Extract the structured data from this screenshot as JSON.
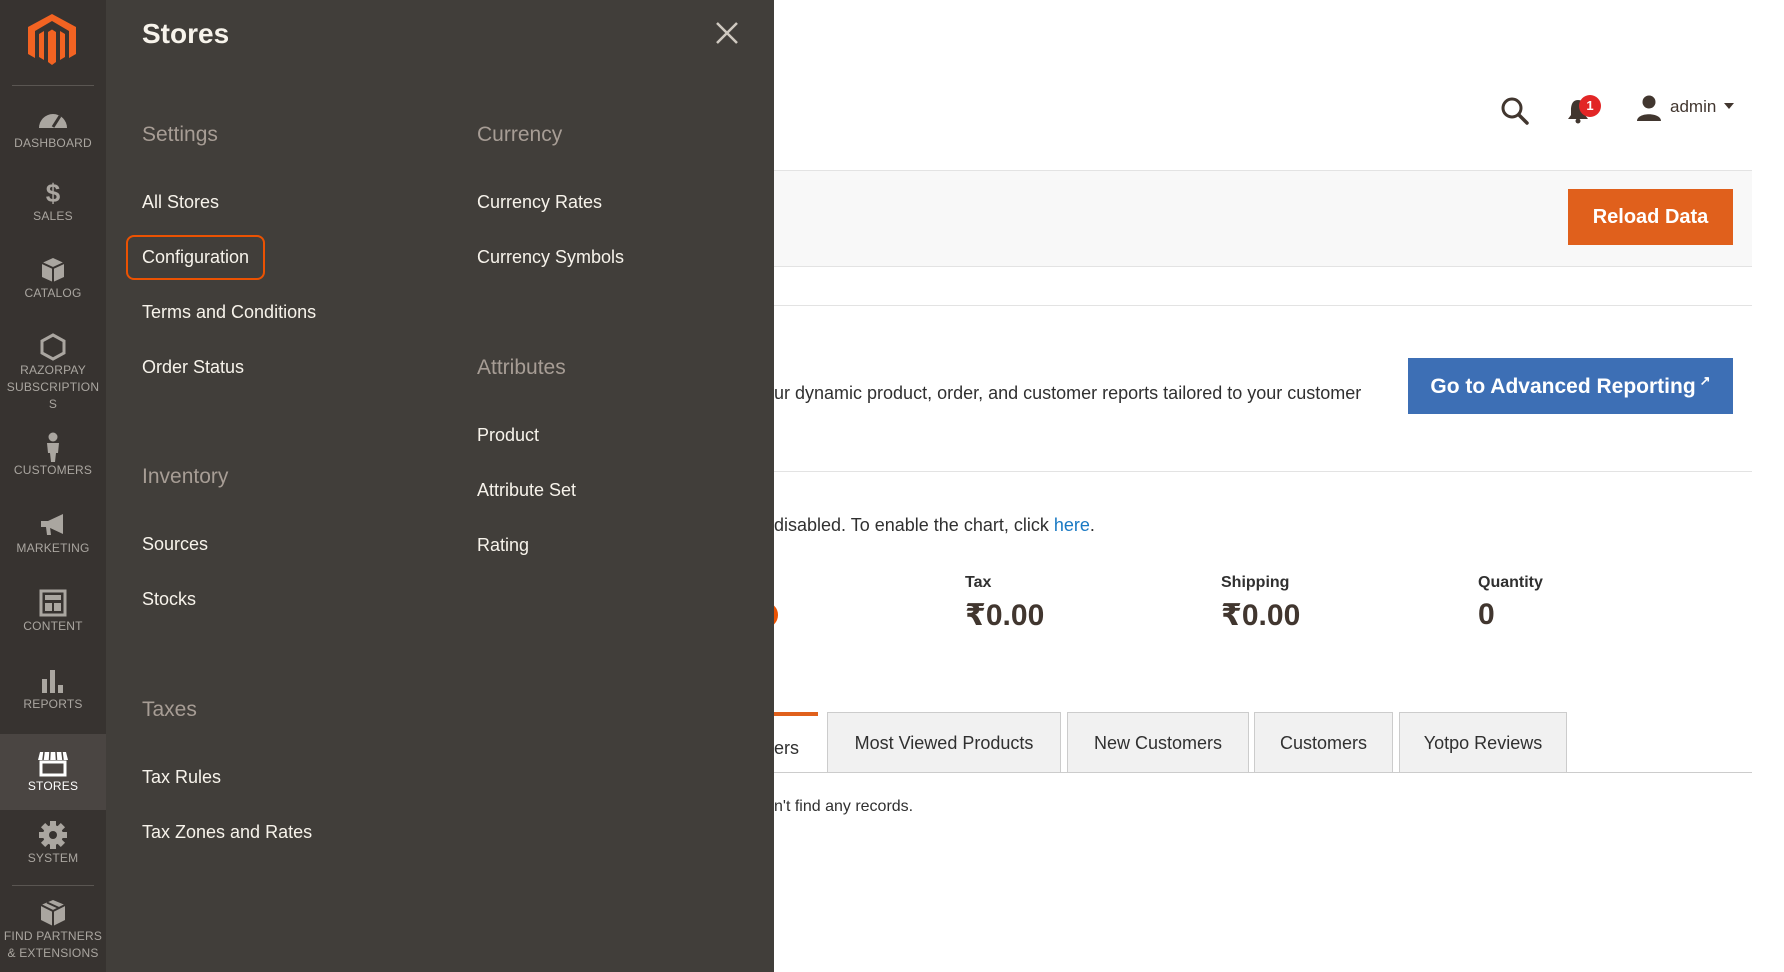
{
  "nav": {
    "items": [
      {
        "label": "DASHBOARD",
        "icon": "dashboard-icon"
      },
      {
        "label": "SALES",
        "icon": "dollar-icon"
      },
      {
        "label": "CATALOG",
        "icon": "box-icon"
      },
      {
        "label_lines": [
          "RAZORPAY",
          "SUBSCRIPTION",
          "S"
        ],
        "icon": "hexagon-icon"
      },
      {
        "label": "CUSTOMERS",
        "icon": "person-icon"
      },
      {
        "label": "MARKETING",
        "icon": "megaphone-icon"
      },
      {
        "label": "CONTENT",
        "icon": "layout-icon"
      },
      {
        "label": "REPORTS",
        "icon": "bar-chart-icon"
      },
      {
        "label": "STORES",
        "icon": "storefront-icon"
      },
      {
        "label": "SYSTEM",
        "icon": "gear-icon"
      },
      {
        "label_lines": [
          "FIND PARTNERS",
          "& EXTENSIONS"
        ],
        "icon": "boxes-icon"
      }
    ],
    "active": "STORES"
  },
  "flyout": {
    "title": "Stores",
    "settings": {
      "title": "Settings",
      "links": [
        "All Stores",
        "Configuration",
        "Terms and Conditions",
        "Order Status"
      ]
    },
    "inventory": {
      "title": "Inventory",
      "links": [
        "Sources",
        "Stocks"
      ]
    },
    "taxes": {
      "title": "Taxes",
      "links": [
        "Tax Rules",
        "Tax Zones and Rates"
      ]
    },
    "currency": {
      "title": "Currency",
      "links": [
        "Currency Rates",
        "Currency Symbols"
      ]
    },
    "attributes": {
      "title": "Attributes",
      "links": [
        "Product",
        "Attribute Set",
        "Rating"
      ]
    },
    "highlighted_link": "Configuration"
  },
  "header": {
    "notification_count": "1",
    "user": "admin"
  },
  "main": {
    "reload_button": "Reload Data",
    "advanced_text": "ur dynamic product, order, and customer reports tailored to your customer",
    "advanced_button": "Go to Advanced Reporting",
    "chart_msg_prefix": "disabled. To enable the chart, click ",
    "chart_msg_link": "here",
    "chart_msg_suffix": ".",
    "stats": [
      {
        "label": "Tax",
        "value": "₹0.00"
      },
      {
        "label": "Shipping",
        "value": "₹0.00"
      },
      {
        "label": "Quantity",
        "value": "0"
      }
    ],
    "tabs": {
      "active_fragment": "ers",
      "items": [
        "Most Viewed Products",
        "New Customers",
        "Customers",
        "Yotpo Reviews"
      ]
    },
    "no_records": "n't find any records."
  },
  "colors": {
    "nav_bg": "#373330",
    "flyout_bg": "#413e3a",
    "accent_orange": "#e0601c",
    "highlight_border": "#eb5202",
    "advanced_button": "#3d6fb5",
    "badge_red": "#e22626"
  }
}
